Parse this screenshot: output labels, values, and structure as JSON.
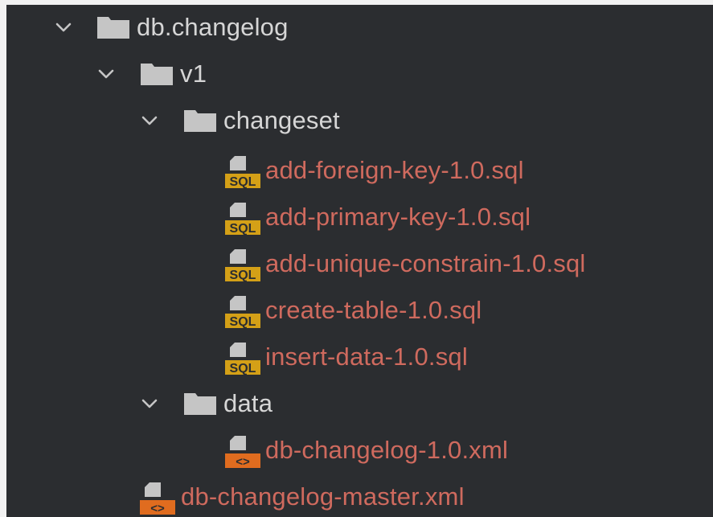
{
  "tree": {
    "root": {
      "label": "db.changelog",
      "icon": "folder-icon",
      "expanded": true
    },
    "v1": {
      "label": "v1",
      "icon": "folder-icon",
      "expanded": true
    },
    "changeset": {
      "label": "changeset",
      "icon": "folder-icon",
      "expanded": true
    },
    "changeset_files": [
      {
        "label": "add-foreign-key-1.0.sql",
        "icon": "sql-file-icon"
      },
      {
        "label": "add-primary-key-1.0.sql",
        "icon": "sql-file-icon"
      },
      {
        "label": "add-unique-constrain-1.0.sql",
        "icon": "sql-file-icon"
      },
      {
        "label": "create-table-1.0.sql",
        "icon": "sql-file-icon"
      },
      {
        "label": "insert-data-1.0.sql",
        "icon": "sql-file-icon"
      }
    ],
    "data": {
      "label": "data",
      "icon": "folder-icon",
      "expanded": true
    },
    "data_files": [
      {
        "label": "db-changelog-1.0.xml",
        "icon": "xml-file-icon"
      }
    ],
    "v1_files": [
      {
        "label": "db-changelog-master.xml",
        "icon": "xml-file-icon"
      }
    ]
  },
  "colors": {
    "background": "#2b2d30",
    "folder_text": "#d6d6d6",
    "modified_file_text": "#cf6a5e",
    "folder_icon": "#c5c5c5",
    "sql_badge": "#d4a017",
    "xml_badge": "#e06c1f"
  }
}
